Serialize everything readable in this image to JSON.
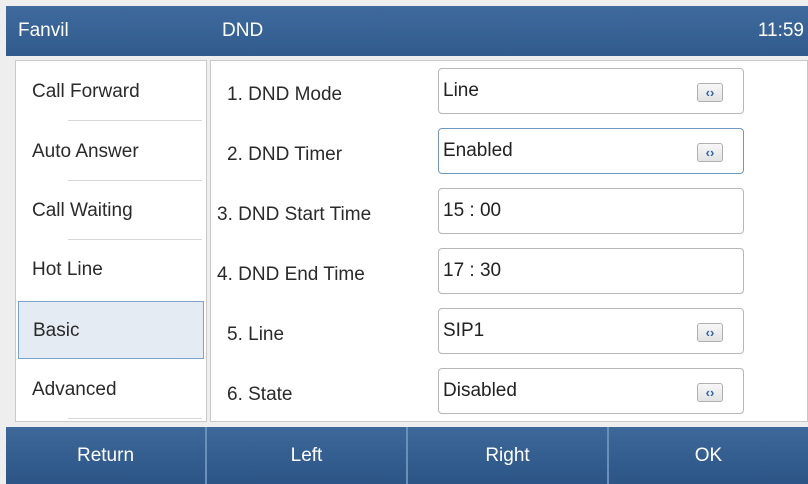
{
  "header": {
    "brand": "Fanvil",
    "title": "DND",
    "time": "11:59"
  },
  "sidebar": {
    "items": [
      {
        "label": "Call Forward",
        "active": false
      },
      {
        "label": "Auto Answer",
        "active": false
      },
      {
        "label": "Call Waiting",
        "active": false
      },
      {
        "label": "Hot Line",
        "active": false
      },
      {
        "label": "Basic",
        "active": true
      },
      {
        "label": "Advanced",
        "active": false
      }
    ]
  },
  "settings": [
    {
      "label": "1. DND Mode",
      "value": "Line",
      "has_selector": true,
      "focused": false
    },
    {
      "label": "2. DND Timer",
      "value": "Enabled",
      "has_selector": true,
      "focused": true
    },
    {
      "label": "3. DND Start Time",
      "value": "15 : 00",
      "has_selector": false,
      "focused": false
    },
    {
      "label": "4. DND End Time",
      "value": "17 : 30",
      "has_selector": false,
      "focused": false
    },
    {
      "label": "5. Line",
      "value": "SIP1",
      "has_selector": true,
      "focused": false
    },
    {
      "label": "6. State",
      "value": "Disabled",
      "has_selector": true,
      "focused": false
    }
  ],
  "selector_icon": "left-right-arrows-icon",
  "softkeys": {
    "return": "Return",
    "left": "Left",
    "right": "Right",
    "ok": "OK"
  },
  "colors": {
    "accent": "#315b8d",
    "active_item_bg": "#e4ebf2",
    "selector_glyph": "#2e63a7"
  }
}
